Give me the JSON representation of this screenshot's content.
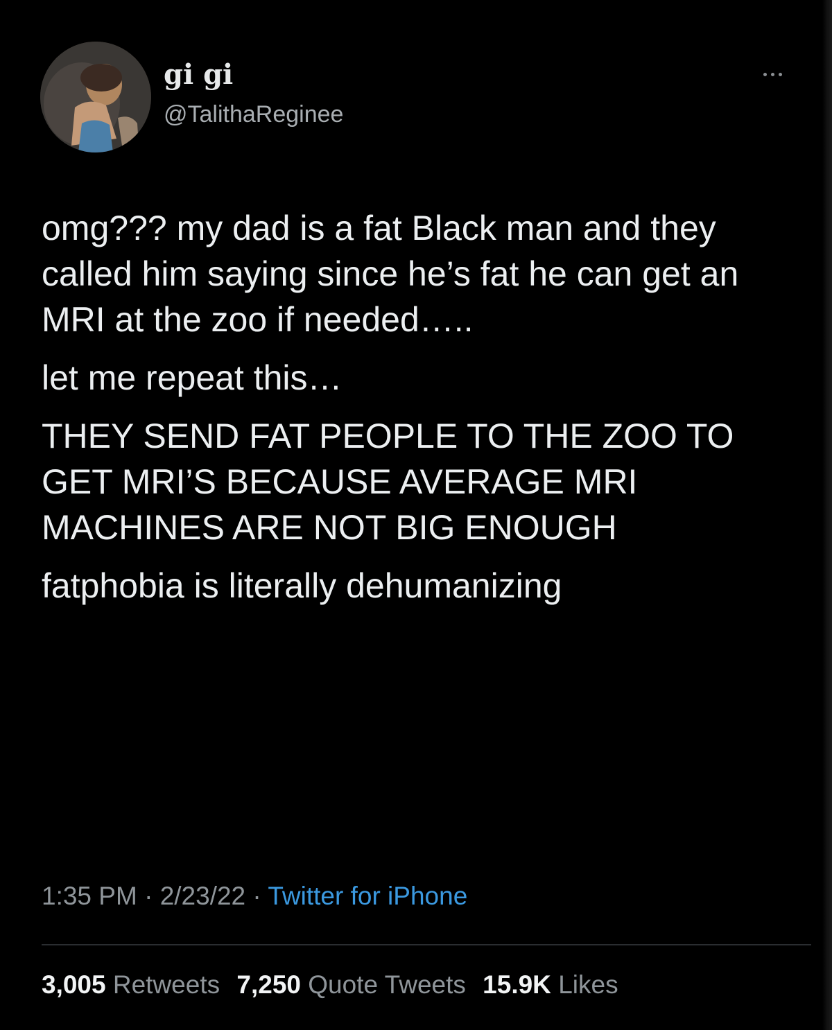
{
  "author": {
    "display_name": "gi gi",
    "handle": "@TalithaReginee"
  },
  "tweet": {
    "paragraphs": [
      "omg??? my dad is a fat Black man and they called him saying since he’s fat he can get an MRI at the zoo if needed…..",
      "let me repeat this…",
      "THEY SEND FAT PEOPLE TO THE ZOO TO GET MRI’S BECAUSE AVERAGE MRI MACHINES ARE NOT BIG ENOUGH",
      "fatphobia is literally dehumanizing"
    ],
    "time": "1:35 PM",
    "separator": " · ",
    "date": "2/23/22",
    "source": "Twitter for iPhone"
  },
  "stats": {
    "retweets_count": "3,005",
    "retweets_label": "Retweets",
    "quote_tweets_count": "7,250",
    "quote_tweets_label": "Quote Tweets",
    "likes_count": "15.9K",
    "likes_label": "Likes"
  },
  "colors": {
    "background": "#000000",
    "text": "#e7e9ea",
    "secondary": "#8f959a",
    "link": "#3b99e0"
  },
  "icons": {
    "more": "more-horizontal-icon"
  }
}
